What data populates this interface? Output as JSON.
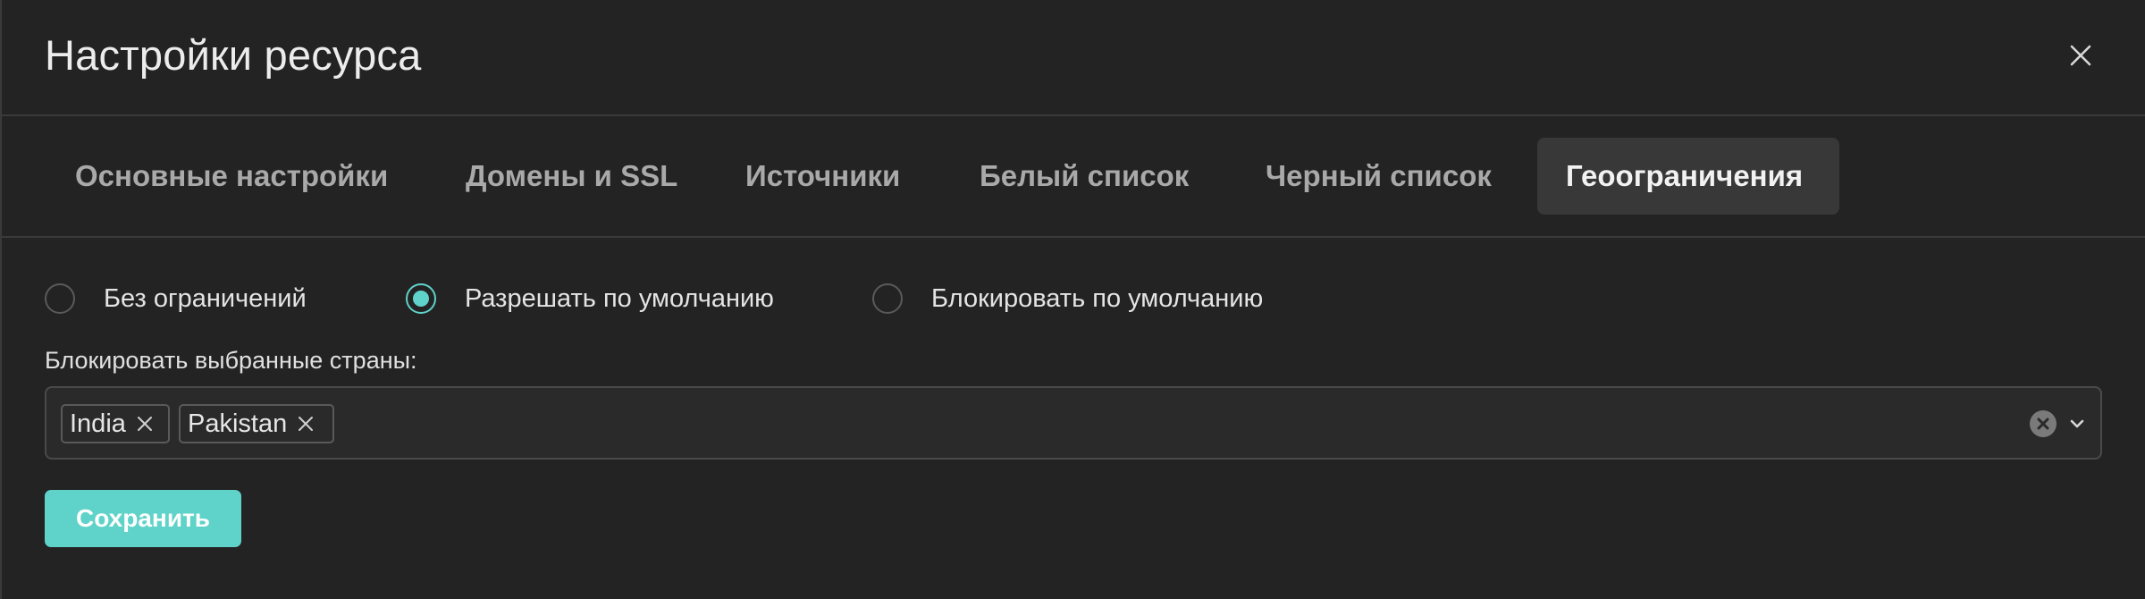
{
  "dialog": {
    "title": "Настройки ресурса",
    "close_icon": "close-icon"
  },
  "tabs": [
    {
      "label": "Основные настройки",
      "active": false
    },
    {
      "label": "Домены и SSL",
      "active": false
    },
    {
      "label": "Источники",
      "active": false
    },
    {
      "label": "Белый список",
      "active": false
    },
    {
      "label": "Черный список",
      "active": false
    },
    {
      "label": "Геоограничения",
      "active": true
    }
  ],
  "geo": {
    "options": [
      {
        "label": "Без ограничений",
        "checked": false
      },
      {
        "label": "Разрешать по умолчанию",
        "checked": true
      },
      {
        "label": "Блокировать по умолчанию",
        "checked": false
      }
    ],
    "countries_label": "Блокировать выбранные страны:",
    "selected_countries": [
      "India",
      "Pakistan"
    ],
    "clear_icon": "clear-circle-icon",
    "dropdown_icon": "chevron-down-icon"
  },
  "actions": {
    "save_label": "Сохранить"
  },
  "colors": {
    "background": "#232323",
    "accent": "#5fd3c9",
    "active_tab": "#383838",
    "border": "#3a3a3a"
  }
}
